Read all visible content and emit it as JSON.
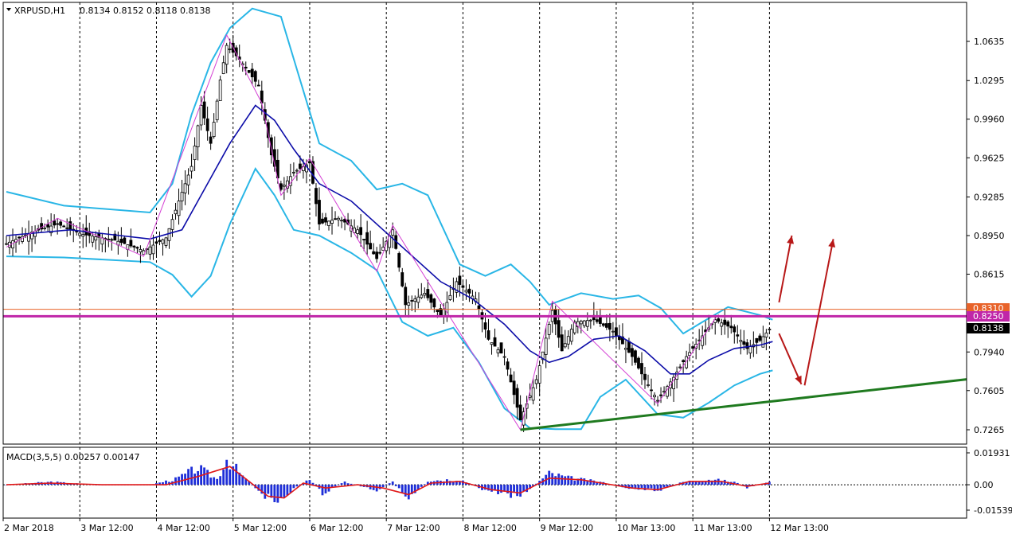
{
  "header": {
    "symbol": "XRPUSD,H1",
    "ohlc": "0.8134 0.8152 0.8118 0.8138"
  },
  "macd": {
    "title": "MACD(3,5,5) 0.00257 0.00147",
    "tick_labels": [
      "0.01931",
      "0.00",
      "-0.01539"
    ],
    "zero_label": "0.00"
  },
  "price_badges": {
    "current": "0.8138",
    "level_a": "0.8250",
    "level_b": "0.8310"
  },
  "colors": {
    "bollinger": "#29b6e6",
    "ma": "#0c0ca8",
    "zigzag": "#d43fd4",
    "support": "#1f7a1f",
    "resistance": "#c026a8",
    "resistance2": "#e8632a",
    "arrows": "#b81818",
    "macd_hist": "#1e2ed8",
    "macd_signal": "#e01818"
  },
  "chart_data": {
    "type": "candlestick",
    "symbol": "XRPUSD",
    "timeframe": "H1",
    "y_ticks": [
      1.0635,
      1.0295,
      0.996,
      0.9625,
      0.9285,
      0.895,
      0.8615,
      0.794,
      0.7605,
      0.7265
    ],
    "y_range": [
      0.7265,
      1.0635
    ],
    "x_labels": [
      "2 Mar 2018",
      "3 Mar 12:00",
      "4 Mar 12:00",
      "5 Mar 12:00",
      "6 Mar 12:00",
      "7 Mar 12:00",
      "8 Mar 12:00",
      "9 Mar 12:00",
      "10 Mar 13:00",
      "11 Mar 13:00",
      "12 Mar 13:00"
    ],
    "x_index": [
      0,
      24,
      48,
      72,
      96,
      120,
      144,
      168,
      192,
      216,
      240
    ],
    "horizontal_lines": [
      {
        "price": 0.831,
        "color": "#e8632a"
      },
      {
        "price": 0.825,
        "color": "#c026a8"
      }
    ],
    "support_line": {
      "from": {
        "index": 161,
        "price": 0.7265
      },
      "to": {
        "index": 300,
        "price": 0.77
      }
    },
    "zigzag": [
      {
        "i": 0,
        "p": 0.885
      },
      {
        "i": 16,
        "p": 0.91
      },
      {
        "i": 43,
        "p": 0.877
      },
      {
        "i": 69,
        "p": 1.069
      },
      {
        "i": 80,
        "p": 1.01
      },
      {
        "i": 86,
        "p": 0.93
      },
      {
        "i": 95,
        "p": 0.962
      },
      {
        "i": 116,
        "p": 0.864
      },
      {
        "i": 121,
        "p": 0.904
      },
      {
        "i": 161,
        "p": 0.7265
      },
      {
        "i": 171,
        "p": 0.838
      },
      {
        "i": 204,
        "p": 0.749
      },
      {
        "i": 222,
        "p": 0.823
      }
    ],
    "close_path": [
      {
        "i": 0,
        "p": 0.888
      },
      {
        "i": 8,
        "p": 0.898
      },
      {
        "i": 16,
        "p": 0.905
      },
      {
        "i": 24,
        "p": 0.896
      },
      {
        "i": 34,
        "p": 0.891
      },
      {
        "i": 43,
        "p": 0.882
      },
      {
        "i": 50,
        "p": 0.893
      },
      {
        "i": 54,
        "p": 0.925
      },
      {
        "i": 58,
        "p": 0.955
      },
      {
        "i": 61,
        "p": 1.008
      },
      {
        "i": 64,
        "p": 0.975
      },
      {
        "i": 67,
        "p": 1.03
      },
      {
        "i": 69,
        "p": 1.06
      },
      {
        "i": 73,
        "p": 1.048
      },
      {
        "i": 79,
        "p": 1.025
      },
      {
        "i": 83,
        "p": 0.965
      },
      {
        "i": 86,
        "p": 0.935
      },
      {
        "i": 90,
        "p": 0.95
      },
      {
        "i": 95,
        "p": 0.958
      },
      {
        "i": 98,
        "p": 0.905
      },
      {
        "i": 104,
        "p": 0.91
      },
      {
        "i": 110,
        "p": 0.9
      },
      {
        "i": 116,
        "p": 0.875
      },
      {
        "i": 121,
        "p": 0.9
      },
      {
        "i": 125,
        "p": 0.835
      },
      {
        "i": 131,
        "p": 0.845
      },
      {
        "i": 136,
        "p": 0.825
      },
      {
        "i": 141,
        "p": 0.855
      },
      {
        "i": 147,
        "p": 0.84
      },
      {
        "i": 151,
        "p": 0.805
      },
      {
        "i": 156,
        "p": 0.79
      },
      {
        "i": 161,
        "p": 0.735
      },
      {
        "i": 166,
        "p": 0.77
      },
      {
        "i": 171,
        "p": 0.83
      },
      {
        "i": 174,
        "p": 0.795
      },
      {
        "i": 178,
        "p": 0.82
      },
      {
        "i": 184,
        "p": 0.822
      },
      {
        "i": 190,
        "p": 0.812
      },
      {
        "i": 196,
        "p": 0.79
      },
      {
        "i": 200,
        "p": 0.77
      },
      {
        "i": 204,
        "p": 0.752
      },
      {
        "i": 209,
        "p": 0.772
      },
      {
        "i": 213,
        "p": 0.79
      },
      {
        "i": 218,
        "p": 0.808
      },
      {
        "i": 222,
        "p": 0.822
      },
      {
        "i": 227,
        "p": 0.815
      },
      {
        "i": 232,
        "p": 0.797
      },
      {
        "i": 236,
        "p": 0.804
      },
      {
        "i": 239,
        "p": 0.8138
      }
    ],
    "ma_path": [
      {
        "i": 0,
        "p": 0.895
      },
      {
        "i": 20,
        "p": 0.9
      },
      {
        "i": 45,
        "p": 0.892
      },
      {
        "i": 55,
        "p": 0.9
      },
      {
        "i": 62,
        "p": 0.935
      },
      {
        "i": 70,
        "p": 0.975
      },
      {
        "i": 78,
        "p": 1.008
      },
      {
        "i": 84,
        "p": 0.995
      },
      {
        "i": 90,
        "p": 0.97
      },
      {
        "i": 98,
        "p": 0.94
      },
      {
        "i": 108,
        "p": 0.925
      },
      {
        "i": 118,
        "p": 0.9
      },
      {
        "i": 126,
        "p": 0.88
      },
      {
        "i": 136,
        "p": 0.855
      },
      {
        "i": 146,
        "p": 0.84
      },
      {
        "i": 156,
        "p": 0.818
      },
      {
        "i": 164,
        "p": 0.795
      },
      {
        "i": 170,
        "p": 0.785
      },
      {
        "i": 176,
        "p": 0.79
      },
      {
        "i": 184,
        "p": 0.805
      },
      {
        "i": 192,
        "p": 0.808
      },
      {
        "i": 200,
        "p": 0.795
      },
      {
        "i": 208,
        "p": 0.775
      },
      {
        "i": 214,
        "p": 0.775
      },
      {
        "i": 220,
        "p": 0.787
      },
      {
        "i": 228,
        "p": 0.797
      },
      {
        "i": 236,
        "p": 0.8
      },
      {
        "i": 240,
        "p": 0.803
      }
    ],
    "bb_upper": [
      {
        "i": 0,
        "p": 0.933
      },
      {
        "i": 18,
        "p": 0.921
      },
      {
        "i": 45,
        "p": 0.915
      },
      {
        "i": 52,
        "p": 0.94
      },
      {
        "i": 58,
        "p": 1.0
      },
      {
        "i": 64,
        "p": 1.045
      },
      {
        "i": 70,
        "p": 1.075
      },
      {
        "i": 77,
        "p": 1.092
      },
      {
        "i": 86,
        "p": 1.085
      },
      {
        "i": 92,
        "p": 1.03
      },
      {
        "i": 98,
        "p": 0.975
      },
      {
        "i": 108,
        "p": 0.96
      },
      {
        "i": 116,
        "p": 0.935
      },
      {
        "i": 124,
        "p": 0.94
      },
      {
        "i": 132,
        "p": 0.93
      },
      {
        "i": 142,
        "p": 0.87
      },
      {
        "i": 150,
        "p": 0.86
      },
      {
        "i": 158,
        "p": 0.87
      },
      {
        "i": 164,
        "p": 0.855
      },
      {
        "i": 170,
        "p": 0.835
      },
      {
        "i": 180,
        "p": 0.845
      },
      {
        "i": 190,
        "p": 0.84
      },
      {
        "i": 198,
        "p": 0.843
      },
      {
        "i": 205,
        "p": 0.832
      },
      {
        "i": 212,
        "p": 0.81
      },
      {
        "i": 218,
        "p": 0.82
      },
      {
        "i": 226,
        "p": 0.833
      },
      {
        "i": 236,
        "p": 0.826
      },
      {
        "i": 240,
        "p": 0.822
      }
    ],
    "bb_lower": [
      {
        "i": 0,
        "p": 0.877
      },
      {
        "i": 18,
        "p": 0.876
      },
      {
        "i": 45,
        "p": 0.872
      },
      {
        "i": 52,
        "p": 0.861
      },
      {
        "i": 58,
        "p": 0.842
      },
      {
        "i": 64,
        "p": 0.86
      },
      {
        "i": 70,
        "p": 0.905
      },
      {
        "i": 78,
        "p": 0.953
      },
      {
        "i": 84,
        "p": 0.93
      },
      {
        "i": 90,
        "p": 0.9
      },
      {
        "i": 98,
        "p": 0.895
      },
      {
        "i": 108,
        "p": 0.88
      },
      {
        "i": 116,
        "p": 0.865
      },
      {
        "i": 124,
        "p": 0.82
      },
      {
        "i": 132,
        "p": 0.808
      },
      {
        "i": 140,
        "p": 0.815
      },
      {
        "i": 148,
        "p": 0.785
      },
      {
        "i": 156,
        "p": 0.745
      },
      {
        "i": 164,
        "p": 0.728
      },
      {
        "i": 172,
        "p": 0.727
      },
      {
        "i": 180,
        "p": 0.727
      },
      {
        "i": 186,
        "p": 0.755
      },
      {
        "i": 194,
        "p": 0.77
      },
      {
        "i": 204,
        "p": 0.74
      },
      {
        "i": 212,
        "p": 0.737
      },
      {
        "i": 220,
        "p": 0.75
      },
      {
        "i": 228,
        "p": 0.765
      },
      {
        "i": 236,
        "p": 0.775
      },
      {
        "i": 240,
        "p": 0.778
      }
    ],
    "arrows": [
      {
        "from": {
          "i": 242,
          "p": 0.837
        },
        "to": {
          "i": 246,
          "p": 0.895
        }
      },
      {
        "from": {
          "i": 242,
          "p": 0.81
        },
        "to": {
          "i": 249,
          "p": 0.766
        }
      },
      {
        "from": {
          "i": 250,
          "p": 0.765
        },
        "to": {
          "i": 259,
          "p": 0.892
        }
      }
    ],
    "macd_hist": [
      {
        "i": 0,
        "p": 0.0
      },
      {
        "i": 14,
        "p": 0.002
      },
      {
        "i": 28,
        "p": 0.0
      },
      {
        "i": 45,
        "p": 0.0
      },
      {
        "i": 53,
        "p": 0.004
      },
      {
        "i": 60,
        "p": 0.012
      },
      {
        "i": 66,
        "p": 0.004
      },
      {
        "i": 69,
        "p": 0.019
      },
      {
        "i": 74,
        "p": 0.006
      },
      {
        "i": 79,
        "p": -0.004
      },
      {
        "i": 84,
        "p": -0.013
      },
      {
        "i": 88,
        "p": -0.006
      },
      {
        "i": 95,
        "p": 0.004
      },
      {
        "i": 99,
        "p": -0.006
      },
      {
        "i": 106,
        "p": 0.002
      },
      {
        "i": 116,
        "p": -0.004
      },
      {
        "i": 121,
        "p": 0.002
      },
      {
        "i": 126,
        "p": -0.012
      },
      {
        "i": 132,
        "p": 0.003
      },
      {
        "i": 142,
        "p": 0.004
      },
      {
        "i": 150,
        "p": -0.004
      },
      {
        "i": 161,
        "p": -0.008
      },
      {
        "i": 170,
        "p": 0.008
      },
      {
        "i": 176,
        "p": 0.005
      },
      {
        "i": 186,
        "p": 0.002
      },
      {
        "i": 196,
        "p": -0.003
      },
      {
        "i": 204,
        "p": -0.004
      },
      {
        "i": 212,
        "p": 0.002
      },
      {
        "i": 220,
        "p": 0.004
      },
      {
        "i": 228,
        "p": 0.002
      },
      {
        "i": 232,
        "p": -0.002
      },
      {
        "i": 239,
        "p": 0.002
      }
    ],
    "macd_signal": [
      {
        "i": 0,
        "p": 0.0
      },
      {
        "i": 14,
        "p": 0.001
      },
      {
        "i": 30,
        "p": 0.0
      },
      {
        "i": 50,
        "p": 0.0
      },
      {
        "i": 60,
        "p": 0.005
      },
      {
        "i": 70,
        "p": 0.011
      },
      {
        "i": 76,
        "p": 0.002
      },
      {
        "i": 82,
        "p": -0.007
      },
      {
        "i": 87,
        "p": -0.008
      },
      {
        "i": 93,
        "p": 0.001
      },
      {
        "i": 100,
        "p": -0.002
      },
      {
        "i": 110,
        "p": 0.0
      },
      {
        "i": 118,
        "p": -0.002
      },
      {
        "i": 126,
        "p": -0.006
      },
      {
        "i": 133,
        "p": 0.001
      },
      {
        "i": 142,
        "p": 0.002
      },
      {
        "i": 152,
        "p": -0.003
      },
      {
        "i": 161,
        "p": -0.005
      },
      {
        "i": 170,
        "p": 0.004
      },
      {
        "i": 180,
        "p": 0.003
      },
      {
        "i": 196,
        "p": -0.002
      },
      {
        "i": 204,
        "p": -0.003
      },
      {
        "i": 214,
        "p": 0.002
      },
      {
        "i": 224,
        "p": 0.002
      },
      {
        "i": 232,
        "p": -0.001
      },
      {
        "i": 239,
        "p": 0.001
      }
    ]
  }
}
